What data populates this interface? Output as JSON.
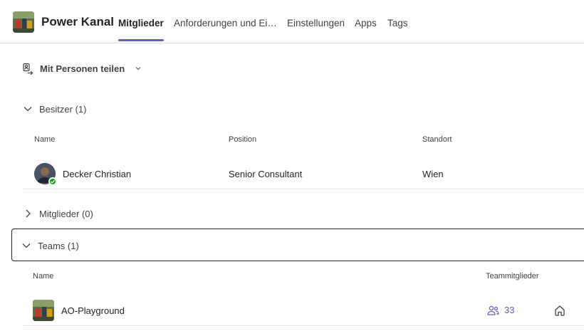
{
  "header": {
    "channel_name": "Power Kanal",
    "tabs": [
      {
        "label": "Mitglieder",
        "active": true
      },
      {
        "label": "Anforderungen und Ei…",
        "active": false
      },
      {
        "label": "Einstellungen",
        "active": false
      },
      {
        "label": "Apps",
        "active": false
      },
      {
        "label": "Tags",
        "active": false
      }
    ]
  },
  "share": {
    "label": "Mit Personen teilen"
  },
  "owners": {
    "heading": "Besitzer (1)",
    "expanded": true,
    "columns": {
      "name": "Name",
      "position": "Position",
      "location": "Standort"
    },
    "rows": [
      {
        "name": "Decker Christian",
        "position": "Senior Consultant",
        "location": "Wien",
        "presence": "available"
      }
    ]
  },
  "members": {
    "heading": "Mitglieder (0)",
    "expanded": false
  },
  "teams": {
    "heading": "Teams (1)",
    "expanded": true,
    "columns": {
      "name": "Name",
      "members": "Teammitglieder"
    },
    "rows": [
      {
        "name": "AO-Playground",
        "member_count": "33"
      }
    ]
  },
  "colors": {
    "accent": "#5b5fc7",
    "presence_available": "#13a10e"
  }
}
